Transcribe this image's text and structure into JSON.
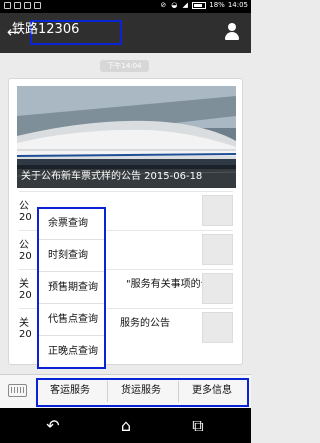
{
  "status_bar": {
    "battery": "18%",
    "time": "14:05"
  },
  "title_bar": {
    "title": "铁路12306"
  },
  "chat": {
    "time_label": "下午14:04",
    "hero_caption": "关于公布新车票式样的公告  2015-06-18"
  },
  "articles": [
    {
      "title": "公",
      "date": "20"
    },
    {
      "title": "公",
      "date": "20"
    },
    {
      "title": "关",
      "suffix": "\"服务有关事项的公告",
      "date": "20"
    },
    {
      "title": "关",
      "suffix": "服务的公告",
      "date": "20"
    }
  ],
  "popup_menu": {
    "items": [
      "余票查询",
      "时刻查询",
      "预售期查询",
      "代售点查询",
      "正晚点查询"
    ]
  },
  "bottom_menu": {
    "tabs": [
      "客运服务",
      "货运服务",
      "更多信息"
    ]
  },
  "icons": {
    "back": "back-arrow-icon",
    "profile": "person-icon",
    "keyboard": "keyboard-icon"
  },
  "colors": {
    "highlight_frame": "#0a23d4",
    "title_bar": "#2f2f2f"
  }
}
